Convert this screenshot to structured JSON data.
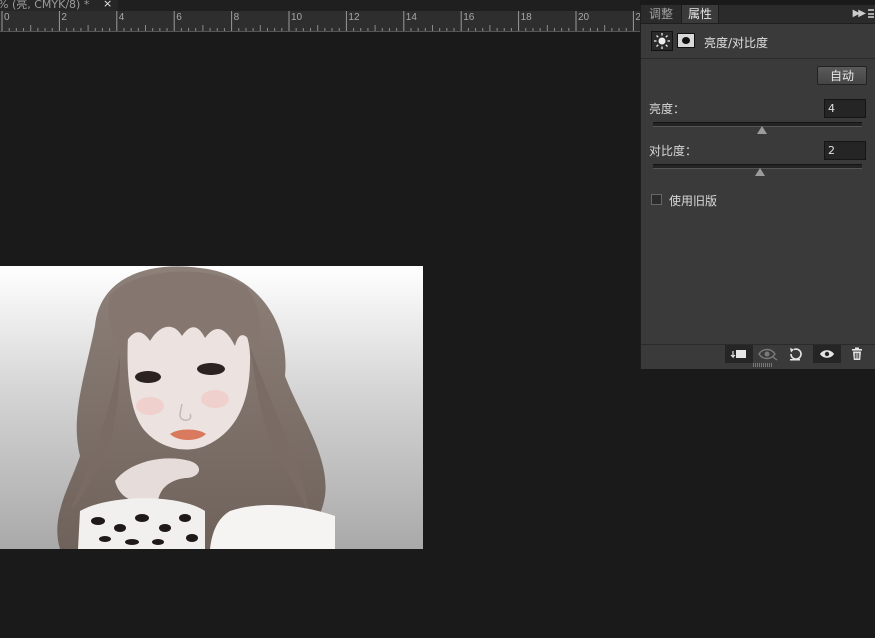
{
  "document_tab": {
    "title": "% (亮, CMYK/8) *",
    "close": "×"
  },
  "ruler": {
    "labels": [
      "0",
      "2",
      "4",
      "6",
      "8",
      "10",
      "12",
      "14",
      "16",
      "18",
      "20",
      "22"
    ]
  },
  "panel": {
    "tabs": {
      "adjustments": "调整",
      "properties": "属性"
    },
    "layer_title": "亮度/对比度",
    "auto_button": "自动",
    "brightness": {
      "label": "亮度：",
      "value": "4",
      "slider_position": 0.52
    },
    "contrast": {
      "label": "对比度：",
      "value": "2",
      "slider_position": 0.51
    },
    "use_legacy": {
      "label": "使用旧版",
      "checked": false
    }
  },
  "icons": {
    "panel_menu": "double-chevron-right-icon",
    "adjustment_layer": "sun-icon",
    "layer_mask": "mask-icon",
    "clip": "clip-to-layer-icon",
    "view_previous": "eye-previous-icon",
    "reset": "reset-icon",
    "visibility": "eye-icon",
    "delete": "trash-icon"
  }
}
